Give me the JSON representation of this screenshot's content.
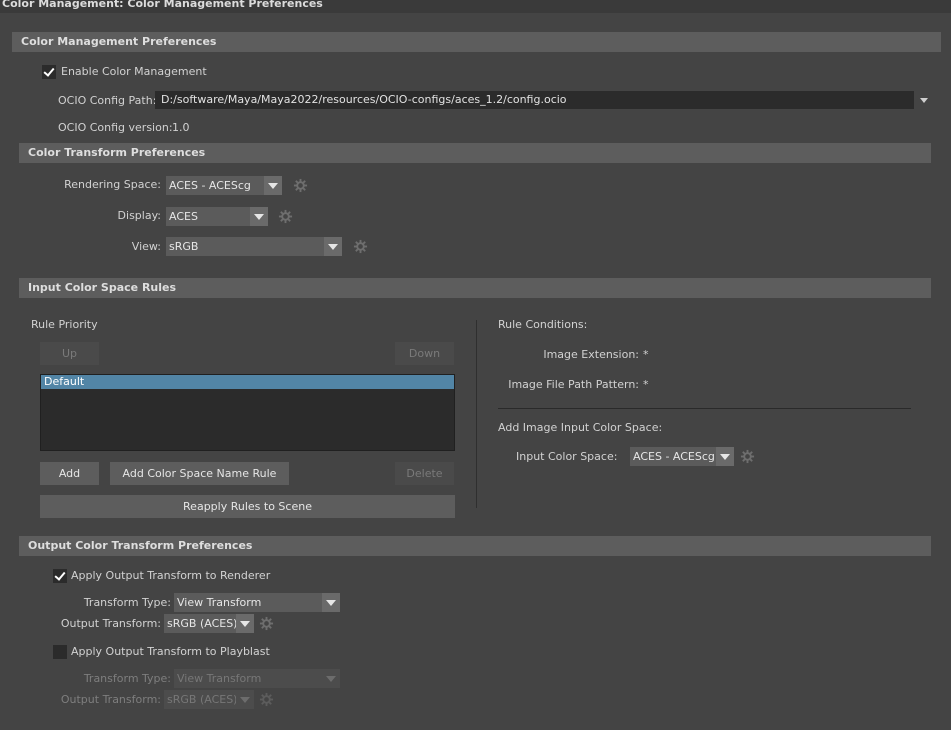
{
  "window": {
    "title": "Color Management: Color Management Preferences"
  },
  "colors": {
    "accent": "#5285a6",
    "section_bg": "#5d5d5d",
    "panel_bg": "#444444",
    "field_bg": "#2b2b2b"
  },
  "cm_prefs": {
    "header": "Color Management Preferences",
    "enable_label": "Enable Color Management",
    "enable_checked": true,
    "ocio_path_label": "OCIO Config Path:",
    "ocio_path_value": "D:/software/Maya/Maya2022/resources/OCIO-configs/aces_1.2/config.ocio",
    "ocio_version_label": "OCIO Config version:",
    "ocio_version_value": "1.0"
  },
  "transform": {
    "header": "Color Transform Preferences",
    "rendering_space_label": "Rendering Space:",
    "rendering_space_value": "ACES - ACEScg",
    "display_label": "Display:",
    "display_value": "ACES",
    "view_label": "View:",
    "view_value": "sRGB"
  },
  "input_rules": {
    "header": "Input Color Space Rules",
    "rule_priority_label": "Rule Priority",
    "up_label": "Up",
    "down_label": "Down",
    "rules": [
      "Default"
    ],
    "add_label": "Add",
    "add_name_rule_label": "Add Color Space Name Rule",
    "delete_label": "Delete",
    "reapply_label": "Reapply Rules to Scene",
    "conditions_label": "Rule Conditions:",
    "image_extension_label": "Image Extension:",
    "image_extension_value": "*",
    "path_pattern_label": "Image File Path Pattern:",
    "path_pattern_value": "*",
    "add_input_cs_label": "Add Image Input Color Space:",
    "input_cs_label": "Input Color Space:",
    "input_cs_value": "ACES - ACEScg"
  },
  "output": {
    "header": "Output Color Transform Preferences",
    "renderer": {
      "apply_label": "Apply Output Transform to Renderer",
      "apply_checked": true,
      "transform_type_label": "Transform Type:",
      "transform_type_value": "View Transform",
      "output_transform_label": "Output Transform:",
      "output_transform_value": "sRGB (ACES)"
    },
    "playblast": {
      "apply_label": "Apply Output Transform to Playblast",
      "apply_checked": false,
      "transform_type_label": "Transform Type:",
      "transform_type_value": "View Transform",
      "output_transform_label": "Output Transform:",
      "output_transform_value": "sRGB (ACES)"
    }
  }
}
